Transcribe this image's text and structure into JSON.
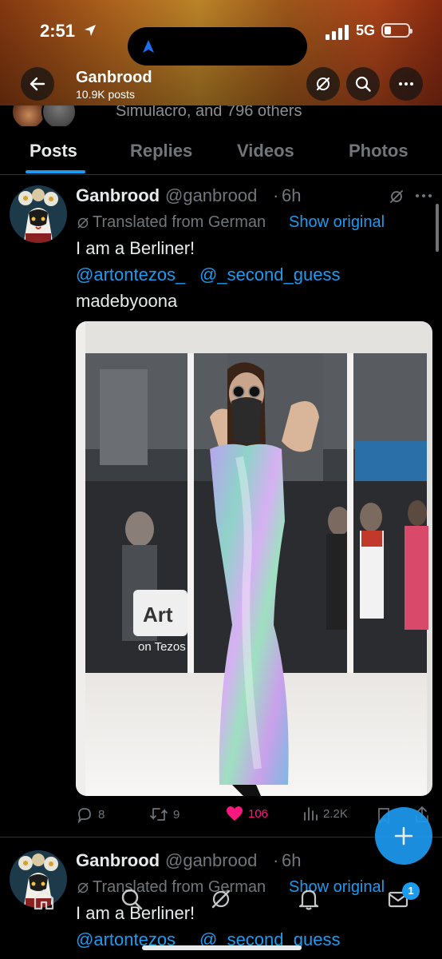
{
  "status_bar": {
    "time": "2:51",
    "network": "5G"
  },
  "header": {
    "title": "Ganbrood",
    "subtitle": "10.9K posts"
  },
  "followers_peek": {
    "text": "Simulacro, and 796 others"
  },
  "tabs": [
    {
      "label": "Posts",
      "active": true
    },
    {
      "label": "Replies",
      "active": false
    },
    {
      "label": "Videos",
      "active": false
    },
    {
      "label": "Photos",
      "active": false
    }
  ],
  "posts": [
    {
      "name": "Ganbrood",
      "handle": "@ganbrood",
      "dot": "·",
      "time": "6h",
      "translated": "Translated from German",
      "show_original": "Show original",
      "text": "I am a Berliner!",
      "mentions": [
        "@artontezos_",
        "@_second_guess"
      ],
      "credit": "madebyoona",
      "media": {
        "sign_line1": "Art",
        "sign_line2": "on Tezos"
      },
      "stats": {
        "replies": "8",
        "reposts": "9",
        "likes": "106",
        "views": "2.2K"
      }
    },
    {
      "name": "Ganbrood",
      "handle": "@ganbrood",
      "dot": "·",
      "time": "6h",
      "translated": "Translated from German",
      "show_original": "Show original",
      "text": "I am a Berliner!",
      "mentions": [
        "@artontezos_",
        "@_second_guess"
      ]
    }
  ],
  "bottom_nav": {
    "messages_badge": "1"
  },
  "colors": {
    "accent": "#1d9bf0",
    "like": "#f91880",
    "text": "#e7e9ea",
    "muted": "#71767b"
  }
}
